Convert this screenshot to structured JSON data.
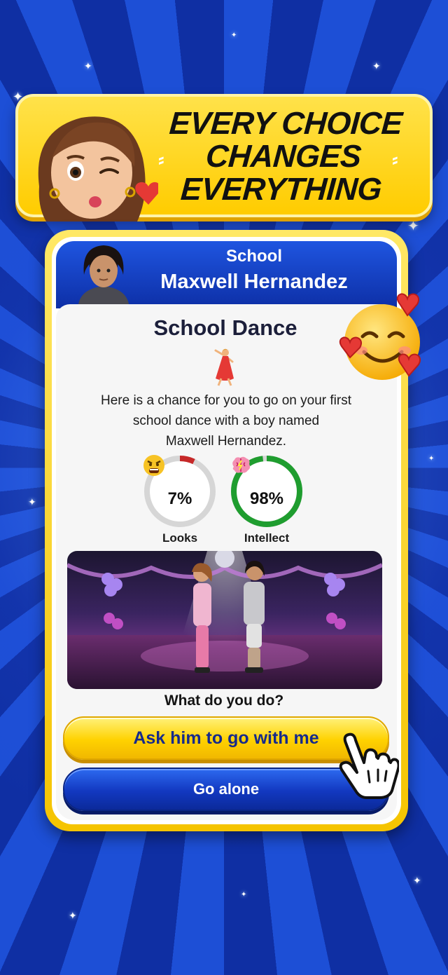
{
  "banner": {
    "lines": [
      "EVERY CHOICE",
      "CHANGES",
      "EVERYTHING"
    ]
  },
  "card": {
    "header": {
      "subtitle": "School",
      "name": "Maxwell Hernandez"
    },
    "event_title": "School Dance",
    "description_lines": [
      "Here is a chance for you to go on your first",
      "school dance with a boy named",
      "Maxwell Hernandez."
    ],
    "stats": [
      {
        "label": "Looks",
        "value": "7%",
        "fraction": 0.07,
        "color": "#c62828",
        "icon": "angry-face-icon"
      },
      {
        "label": "Intellect",
        "value": "98%",
        "fraction": 0.98,
        "color": "#1f9d2f",
        "icon": "brain-icon"
      }
    ],
    "question": "What do you do?",
    "choices": {
      "primary": "Ask him to go with me",
      "secondary": "Go alone"
    }
  },
  "colors": {
    "banner_yellow": "#ffd200",
    "header_blue": "#1238c0",
    "background_blue": "#1d4fd6"
  }
}
